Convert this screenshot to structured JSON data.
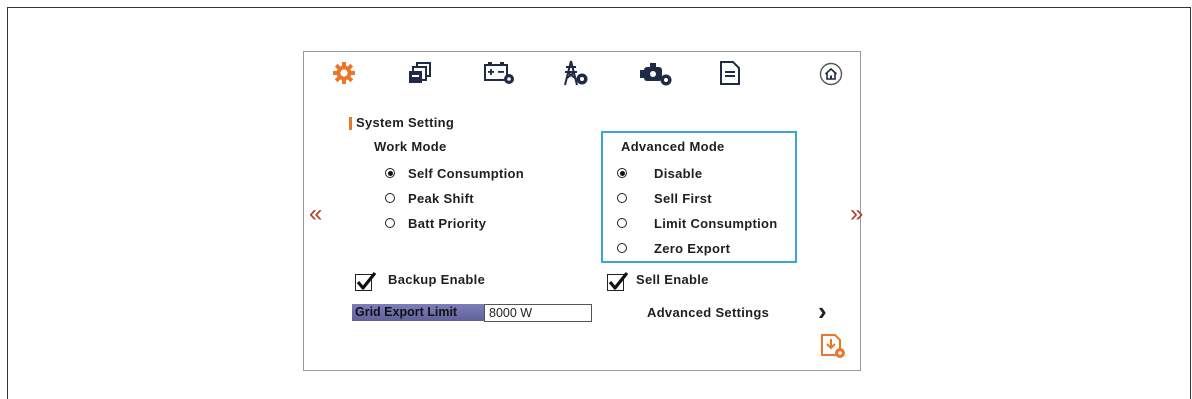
{
  "colors": {
    "accent_orange": "#e8782a",
    "nav_arrow": "#b0412a",
    "adv_box_border": "#3aa6d6",
    "label_bg": "#6d6fa9"
  },
  "toolbar": {
    "icons": [
      "gear-icon",
      "multi-copy-icon",
      "battery-settings-icon",
      "grid-tower-settings-icon",
      "generator-settings-icon",
      "document-icon",
      "home-icon"
    ]
  },
  "section": {
    "title": "System Setting"
  },
  "work_mode": {
    "title": "Work Mode",
    "options": [
      {
        "label": "Self Consumption",
        "selected": true
      },
      {
        "label": "Peak Shift",
        "selected": false
      },
      {
        "label": "Batt Priority",
        "selected": false
      }
    ]
  },
  "advanced_mode": {
    "title": "Advanced Mode",
    "options": [
      {
        "label": "Disable",
        "selected": true
      },
      {
        "label": "Sell First",
        "selected": false
      },
      {
        "label": "Limit Consumption",
        "selected": false
      },
      {
        "label": "Zero Export",
        "selected": false
      }
    ]
  },
  "nav": {
    "prev": "«",
    "next": "»"
  },
  "backup_enable": {
    "label": "Backup Enable",
    "checked": true
  },
  "sell_enable": {
    "label": "Sell Enable",
    "checked": true
  },
  "grid_export_limit": {
    "label": "Grid Export Limit",
    "value": "8000 W"
  },
  "advanced_settings": {
    "label": "Advanced Settings",
    "chevron": "›"
  },
  "save_icon": "save-settings-icon"
}
